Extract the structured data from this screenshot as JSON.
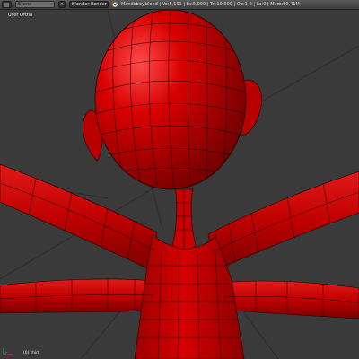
{
  "header": {
    "scene_label": "Scene",
    "close_label": "×",
    "engine_label": "Blender Render",
    "info_text": "Mandeboy.blend | Ve:5,191 | Fa:5,000 | Tri:10,000 | Ob:1-2 | La:0 | Mem:60.41M"
  },
  "viewport": {
    "view_label": "User Ortho",
    "frame_info": "(0) shirt"
  },
  "colors": {
    "model_red": "#d40000",
    "wire": "#1a0000",
    "grid": "#2c2c2c"
  }
}
